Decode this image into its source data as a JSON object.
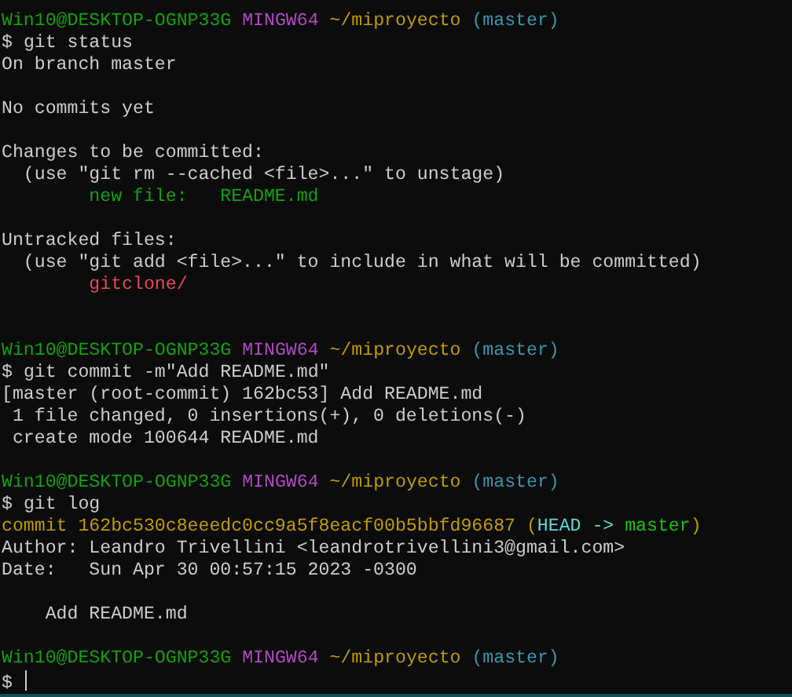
{
  "lines": [
    {
      "kind": "prompt",
      "user_host": "Win10@DESKTOP-OGNP33G",
      "system": "MINGW64",
      "path": "~/miproyecto",
      "branch": "(master)"
    },
    {
      "kind": "command",
      "prompt": "$",
      "command": "git status"
    },
    {
      "kind": "output",
      "segments": [
        {
          "text": "On branch master",
          "color": "#cccccc"
        }
      ]
    },
    {
      "kind": "blank"
    },
    {
      "kind": "output",
      "segments": [
        {
          "text": "No commits yet",
          "color": "#cccccc"
        }
      ]
    },
    {
      "kind": "blank"
    },
    {
      "kind": "output",
      "segments": [
        {
          "text": "Changes to be committed:",
          "color": "#cccccc"
        }
      ]
    },
    {
      "kind": "output",
      "segments": [
        {
          "text": "  (use \"git rm --cached <file>...\" to unstage)",
          "color": "#cccccc"
        }
      ]
    },
    {
      "kind": "output",
      "segments": [
        {
          "text": "        new file:   README.md",
          "color": "#13a10e"
        }
      ]
    },
    {
      "kind": "blank"
    },
    {
      "kind": "output",
      "segments": [
        {
          "text": "Untracked files:",
          "color": "#cccccc"
        }
      ]
    },
    {
      "kind": "output",
      "segments": [
        {
          "text": "  (use \"git add <file>...\" to include in what will be committed)",
          "color": "#cccccc"
        }
      ]
    },
    {
      "kind": "output",
      "segments": [
        {
          "text": "        gitclone/",
          "color": "#e74856"
        }
      ]
    },
    {
      "kind": "blank"
    },
    {
      "kind": "blank"
    },
    {
      "kind": "prompt",
      "user_host": "Win10@DESKTOP-OGNP33G",
      "system": "MINGW64",
      "path": "~/miproyecto",
      "branch": "(master)"
    },
    {
      "kind": "command",
      "prompt": "$",
      "command": "git commit -m\"Add README.md\""
    },
    {
      "kind": "output",
      "segments": [
        {
          "text": "[master (root-commit) 162bc53] Add README.md",
          "color": "#cccccc"
        }
      ]
    },
    {
      "kind": "output",
      "segments": [
        {
          "text": " 1 file changed, 0 insertions(+), 0 deletions(-)",
          "color": "#cccccc"
        }
      ]
    },
    {
      "kind": "output",
      "segments": [
        {
          "text": " create mode 100644 README.md",
          "color": "#cccccc"
        }
      ]
    },
    {
      "kind": "blank"
    },
    {
      "kind": "prompt",
      "user_host": "Win10@DESKTOP-OGNP33G",
      "system": "MINGW64",
      "path": "~/miproyecto",
      "branch": "(master)"
    },
    {
      "kind": "command",
      "prompt": "$",
      "command": "git log"
    },
    {
      "kind": "output",
      "segments": [
        {
          "text": "commit 162bc530c8eeedc0cc9a5f8eacf00b5bbfd96687 (",
          "color": "#c19c00"
        },
        {
          "text": "HEAD ->",
          "color": "#61d6d6"
        },
        {
          "text": " master",
          "color": "#16c60c"
        },
        {
          "text": ")",
          "color": "#c19c00"
        }
      ]
    },
    {
      "kind": "output",
      "segments": [
        {
          "text": "Author: Leandro Trivellini <leandrotrivellini3@gmail.com>",
          "color": "#cccccc"
        }
      ]
    },
    {
      "kind": "output",
      "segments": [
        {
          "text": "Date:   Sun Apr 30 00:57:15 2023 -0300",
          "color": "#cccccc"
        }
      ]
    },
    {
      "kind": "blank"
    },
    {
      "kind": "output",
      "segments": [
        {
          "text": "    Add README.md",
          "color": "#cccccc"
        }
      ]
    },
    {
      "kind": "blank"
    },
    {
      "kind": "prompt",
      "user_host": "Win10@DESKTOP-OGNP33G",
      "system": "MINGW64",
      "path": "~/miproyecto",
      "branch": "(master)"
    },
    {
      "kind": "input",
      "prompt": "$",
      "cursor": true
    }
  ]
}
